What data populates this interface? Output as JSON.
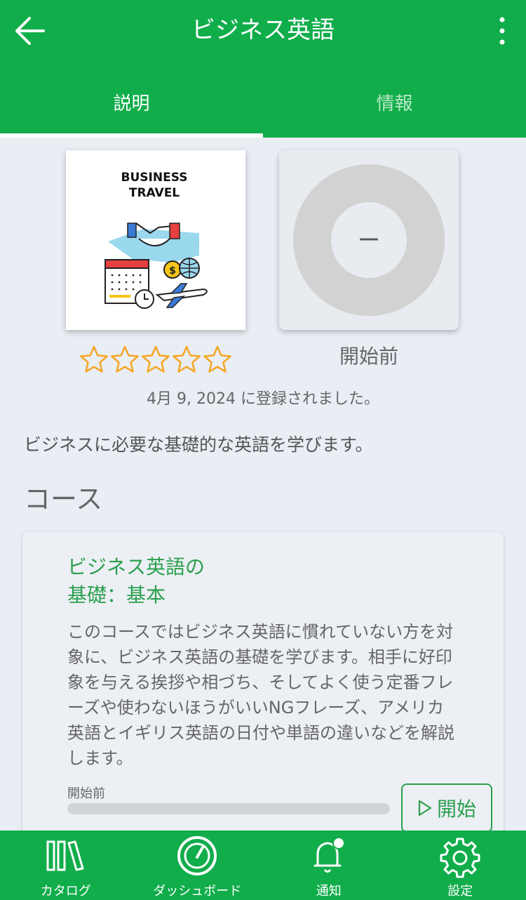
{
  "header": {
    "title": "ビジネス英語",
    "back_icon": "arrow-left-icon",
    "more_icon": "more-vertical-icon"
  },
  "tabs": [
    {
      "label": "説明",
      "active": true
    },
    {
      "label": "情報",
      "active": false
    }
  ],
  "cover": {
    "line1": "BUSINESS",
    "line2": "TRAVEL"
  },
  "rating": {
    "value": 0,
    "max": 5
  },
  "progress": {
    "center_text": "ー",
    "status_label": "開始前"
  },
  "registered_text": "4月 9, 2024 に登録されました。",
  "description": "ビジネスに必要な基礎的な英語を学びます。",
  "section_title": "コース",
  "course": {
    "title": "ビジネス英語の\n基礎：基本",
    "body": "このコースではビジネス英語に慣れていない方を対象に、ビジネス英語の基礎を学びます。相手に好印象を与える挨拶や相づち、そしてよく使う定番フレーズや使わないほうがいいNGフレーズ、アメリカ英語とイギリス英語の日付や単語の違いなどを解説します。",
    "status": "開始前",
    "progress": 0,
    "start_label": "開始"
  },
  "bottom_nav": [
    {
      "label": "カタログ",
      "icon": "books-icon"
    },
    {
      "label": "ダッシュボード",
      "icon": "dashboard-gauge-icon"
    },
    {
      "label": "通知",
      "icon": "bell-icon"
    },
    {
      "label": "設定",
      "icon": "gear-icon"
    }
  ],
  "colors": {
    "primary": "#11ad4b",
    "accent_text": "#2ba04e",
    "star": "#f5a623",
    "background": "#e9edf4"
  }
}
